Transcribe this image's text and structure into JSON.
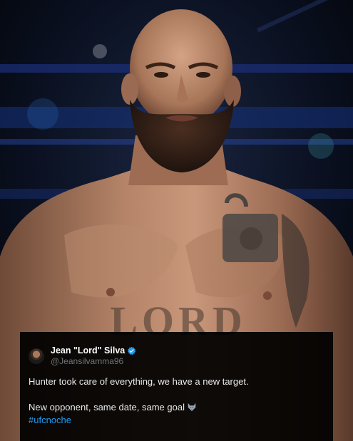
{
  "tweet": {
    "display_name": "Jean \"Lord\" Silva",
    "handle": "@Jeansilvamma96",
    "line1": "Hunter took care of everything, we have a new target.",
    "line2": "New opponent, same date, same goal",
    "emoji": "wolf-emoji",
    "hashtag": "#ufcnoche"
  },
  "photo": {
    "subject": "fighter-portrait",
    "tattoo_chest_text": "LORD"
  },
  "colors": {
    "link": "#1d9bf0",
    "verified": "#1d9bf0",
    "handle": "#71767b",
    "card_bg": "#000000"
  }
}
